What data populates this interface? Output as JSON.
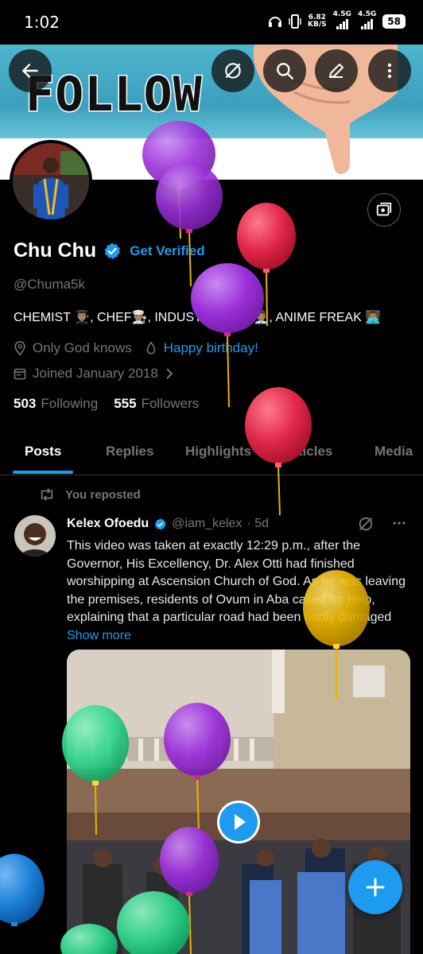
{
  "status_bar": {
    "time": "1:02",
    "speed": "6.82",
    "speed_unit": "KB/S",
    "net1": "4.5G",
    "net2": "4.5G",
    "battery": "58"
  },
  "banner": {
    "text": "FOLLOW"
  },
  "profile": {
    "name": "Chu Chu",
    "get_verified": "Get Verified",
    "handle": "@Chuma5k",
    "bio": "CHEMIST 👨🏽‍🎓, CHEF👨🏽‍🍳, INDUSTRIALIST 👨🏽‍💼, ANIME FREAK 👨🏽‍💻",
    "location": "Only God knows",
    "birthday": "Happy birthday!",
    "joined": "Joined January 2018",
    "following_count": "503",
    "following_label": "Following",
    "followers_count": "555",
    "followers_label": "Followers"
  },
  "tabs": [
    "Posts",
    "Replies",
    "Highlights",
    "Articles",
    "Media"
  ],
  "post": {
    "repost_label": "You reposted",
    "author": "Kelex Ofoedu",
    "handle": "@iam_kelex",
    "time": "· 5d",
    "text": "This video was taken at exactly 12:29 p.m., after the Governor, His Excellency, Dr. Alex Otti had finished worshipping at Ascension Church of God. As he was leaving the premises, residents of Ovum in Aba called for help, explaining that a particular road had been badly damaged",
    "show_more": "Show more"
  },
  "colors": {
    "accent": "#1d9bf0",
    "muted": "#71767b",
    "balloon_purple": "#9b30d9",
    "balloon_red": "#e0284a",
    "balloon_yellow": "#e8b400",
    "balloon_green": "#2fd68c",
    "balloon_blue": "#1e88e5"
  },
  "icons": [
    "back-arrow-icon",
    "grok-icon",
    "search-icon",
    "edit-icon",
    "more-icon",
    "subscriptions-icon",
    "verified-badge-icon",
    "location-icon",
    "birthday-icon",
    "calendar-icon",
    "chevron-right-icon",
    "repost-icon",
    "play-icon",
    "compose-plus-icon"
  ]
}
